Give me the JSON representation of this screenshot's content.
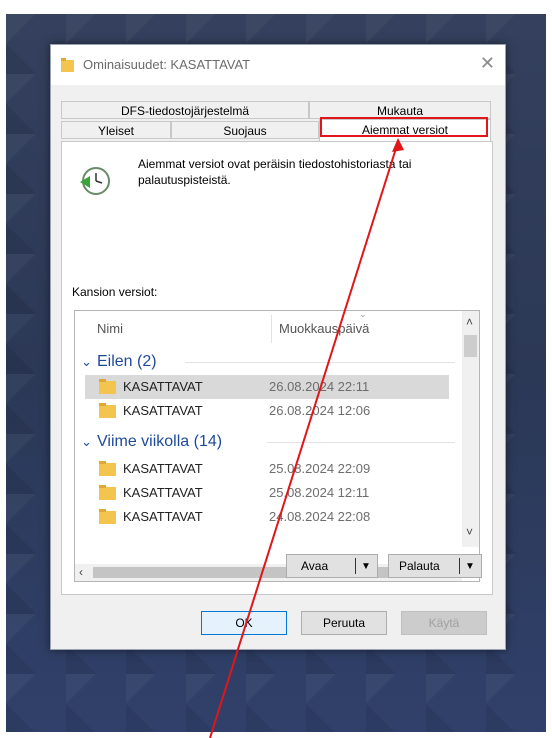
{
  "dialog": {
    "title": "Ominaisuudet: KASATTAVAT",
    "close_symbol": "✕",
    "tabs_row1": [
      {
        "label": "DFS-tiedostojärjestelmä"
      },
      {
        "label": "Mukauta"
      }
    ],
    "tabs_row2": [
      {
        "label": "Yleiset"
      },
      {
        "label": "Suojaus"
      },
      {
        "label": "Aiemmat versiot",
        "active": true
      }
    ],
    "description": "Aiemmat versiot ovat peräisin tiedostohistoriasta tai palautuspisteistä.",
    "list_label": "Kansion versiot:",
    "columns": {
      "name": "Nimi",
      "modified": "Muokkauspäivä"
    },
    "groups": [
      {
        "label": "Eilen (2)",
        "rows": [
          {
            "name": "KASATTAVAT",
            "date": "26.08.2024 22:11",
            "selected": true
          },
          {
            "name": "KASATTAVAT",
            "date": "26.08.2024 12:06",
            "selected": false
          }
        ]
      },
      {
        "label": "Viime viikolla (14)",
        "rows": [
          {
            "name": "KASATTAVAT",
            "date": "25.08.2024 22:09",
            "selected": false
          },
          {
            "name": "KASATTAVAT",
            "date": "25.08.2024 12:11",
            "selected": false
          },
          {
            "name": "KASATTAVAT",
            "date": "24.08.2024 22:08",
            "selected": false
          }
        ]
      }
    ],
    "open_button": "Avaa",
    "restore_button": "Palauta",
    "ok_button": "OK",
    "cancel_button": "Peruuta",
    "apply_button": "Käytä"
  },
  "colors": {
    "annotation": "#e0161b",
    "group_text": "#1e4a9a",
    "folder_yellow": "#f3c54e"
  }
}
